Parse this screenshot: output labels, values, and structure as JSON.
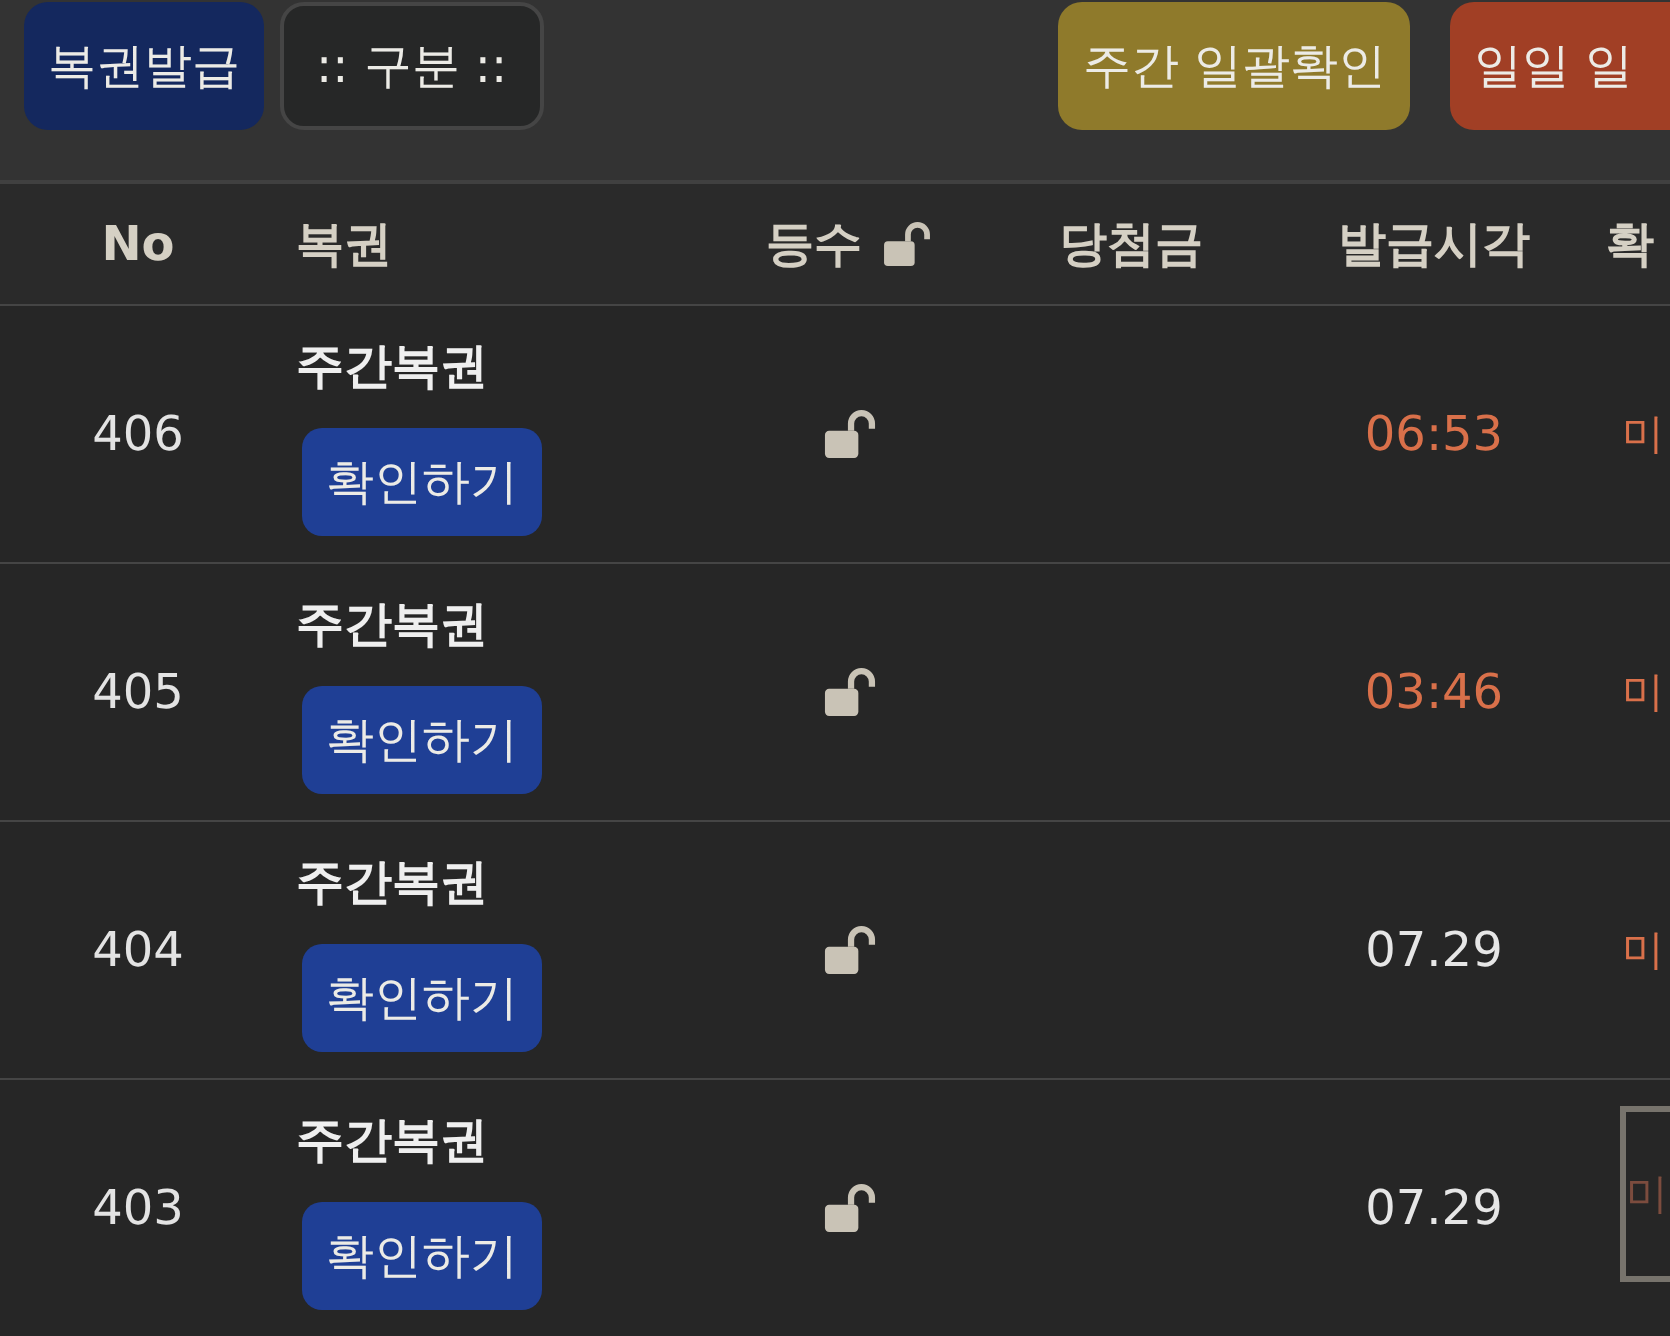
{
  "toolbar": {
    "left_buttons": [
      {
        "label": "복권발급",
        "kind": "primary"
      },
      {
        "label": ":: 구분 ::",
        "kind": "select"
      }
    ],
    "right_buttons": [
      {
        "label": "주간 일괄확인",
        "kind": "weekly"
      },
      {
        "label": "일일 일",
        "kind": "daily"
      }
    ]
  },
  "table": {
    "columns": [
      {
        "label": "No"
      },
      {
        "label": "복권"
      },
      {
        "label": "등수",
        "locked": false
      },
      {
        "label": "당첨금"
      },
      {
        "label": "발급시각"
      },
      {
        "label": "확"
      }
    ],
    "rows": [
      {
        "no": "406",
        "lottery": "주간복권",
        "action": "확인하기",
        "locked": false,
        "time": "06:53",
        "time_highlighted": true,
        "status": "미",
        "focused": false
      },
      {
        "no": "405",
        "lottery": "주간복권",
        "action": "확인하기",
        "locked": false,
        "time": "03:46",
        "time_highlighted": true,
        "status": "미",
        "focused": false
      },
      {
        "no": "404",
        "lottery": "주간복권",
        "action": "확인하기",
        "locked": false,
        "time": "07.29",
        "time_highlighted": false,
        "status": "미",
        "focused": false
      },
      {
        "no": "403",
        "lottery": "주간복권",
        "action": "확인하기",
        "locked": false,
        "time": "07.29",
        "time_highlighted": false,
        "status": "미",
        "focused": true
      }
    ]
  }
}
